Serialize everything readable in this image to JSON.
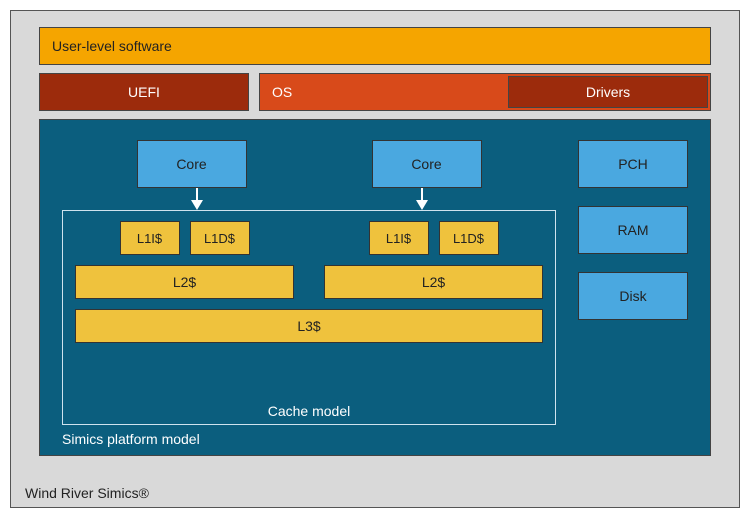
{
  "outer_label": "Wind River Simics®",
  "user_level": "User-level software",
  "uefi": "UEFI",
  "os": "OS",
  "drivers": "Drivers",
  "platform_label": "Simics platform model",
  "cores": [
    "Core",
    "Core"
  ],
  "cache_model_label": "Cache model",
  "l1": {
    "left": [
      "L1I$",
      "L1D$"
    ],
    "right": [
      "L1I$",
      "L1D$"
    ]
  },
  "l2": [
    "L2$",
    "L2$"
  ],
  "l3": "L3$",
  "devices": [
    "PCH",
    "RAM",
    "Disk"
  ]
}
